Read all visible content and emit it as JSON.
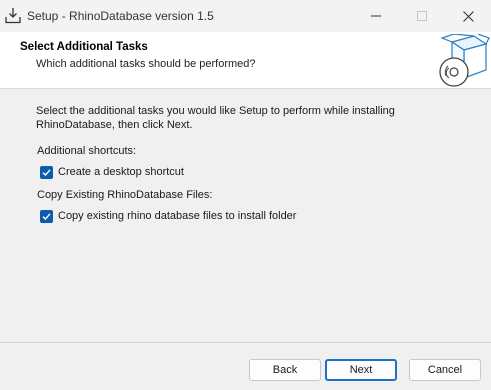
{
  "window": {
    "title": "Setup - RhinoDatabase version 1.5",
    "app_icon": "installer-download-icon",
    "controls": {
      "minimize": "minimize-icon",
      "maximize": "maximize-icon",
      "close": "close-icon"
    }
  },
  "header": {
    "title": "Select Additional Tasks",
    "subtitle": "Which additional tasks should be performed?",
    "icon": "package-disc-icon"
  },
  "main": {
    "description": "Select the additional tasks you would like Setup to perform while installing RhinoDatabase, then click Next.",
    "groups": [
      {
        "label": "Additional shortcuts:",
        "task": {
          "label": "Create a desktop shortcut",
          "checked": true
        }
      },
      {
        "label": "Copy Existing RhinoDatabase Files:",
        "task": {
          "label": "Copy existing rhino database files to install folder",
          "checked": true
        }
      }
    ]
  },
  "buttons": {
    "back": "Back",
    "next": "Next",
    "cancel": "Cancel"
  },
  "colors": {
    "checkbox": "#0b5cad",
    "default_button_border": "#1e6fc9",
    "header_bg": "#ffffff",
    "body_bg": "#f0f0f0"
  }
}
